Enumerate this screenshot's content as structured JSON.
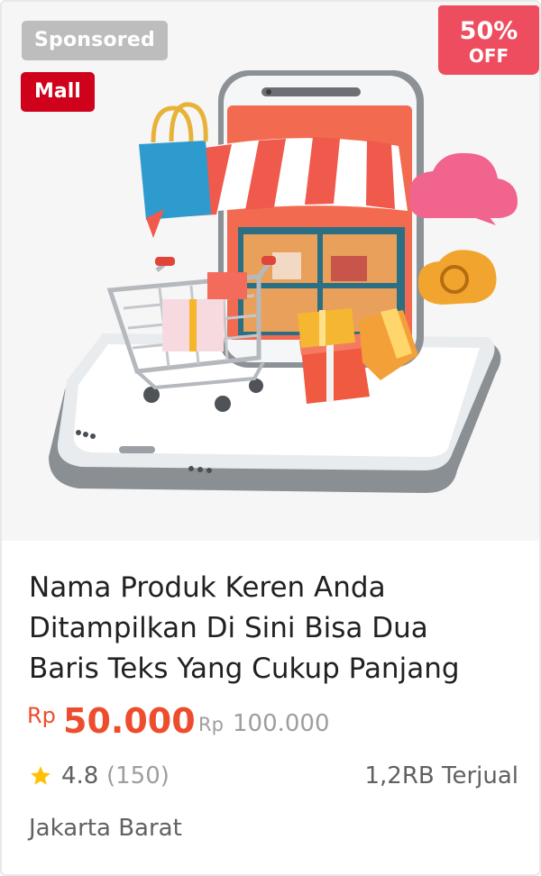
{
  "badges": {
    "sponsored": "Sponsored",
    "mall": "Mall",
    "discount_percent": "50%",
    "discount_off": "OFF"
  },
  "product": {
    "image_icon": "online-shop-illustration",
    "title_lines": [
      "Nama Produk Keren Anda",
      "Ditampilkan Di Sini Bisa Dua",
      "Baris Teks Yang Cukup Panjang"
    ],
    "currency": "Rp",
    "price": "50.000",
    "original_currency": "Rp",
    "original_price": "100.000",
    "rating": "4.8",
    "rating_count": "(150)",
    "sold": "1,2RB Terjual",
    "location": "Jakarta Barat",
    "rating_icon": "star-icon"
  },
  "colors": {
    "accent": "#ee4d2d",
    "mall": "#d0011b",
    "discount": "#ee4d5f",
    "sponsored": "#bdbdbd",
    "star": "#ffc107"
  }
}
